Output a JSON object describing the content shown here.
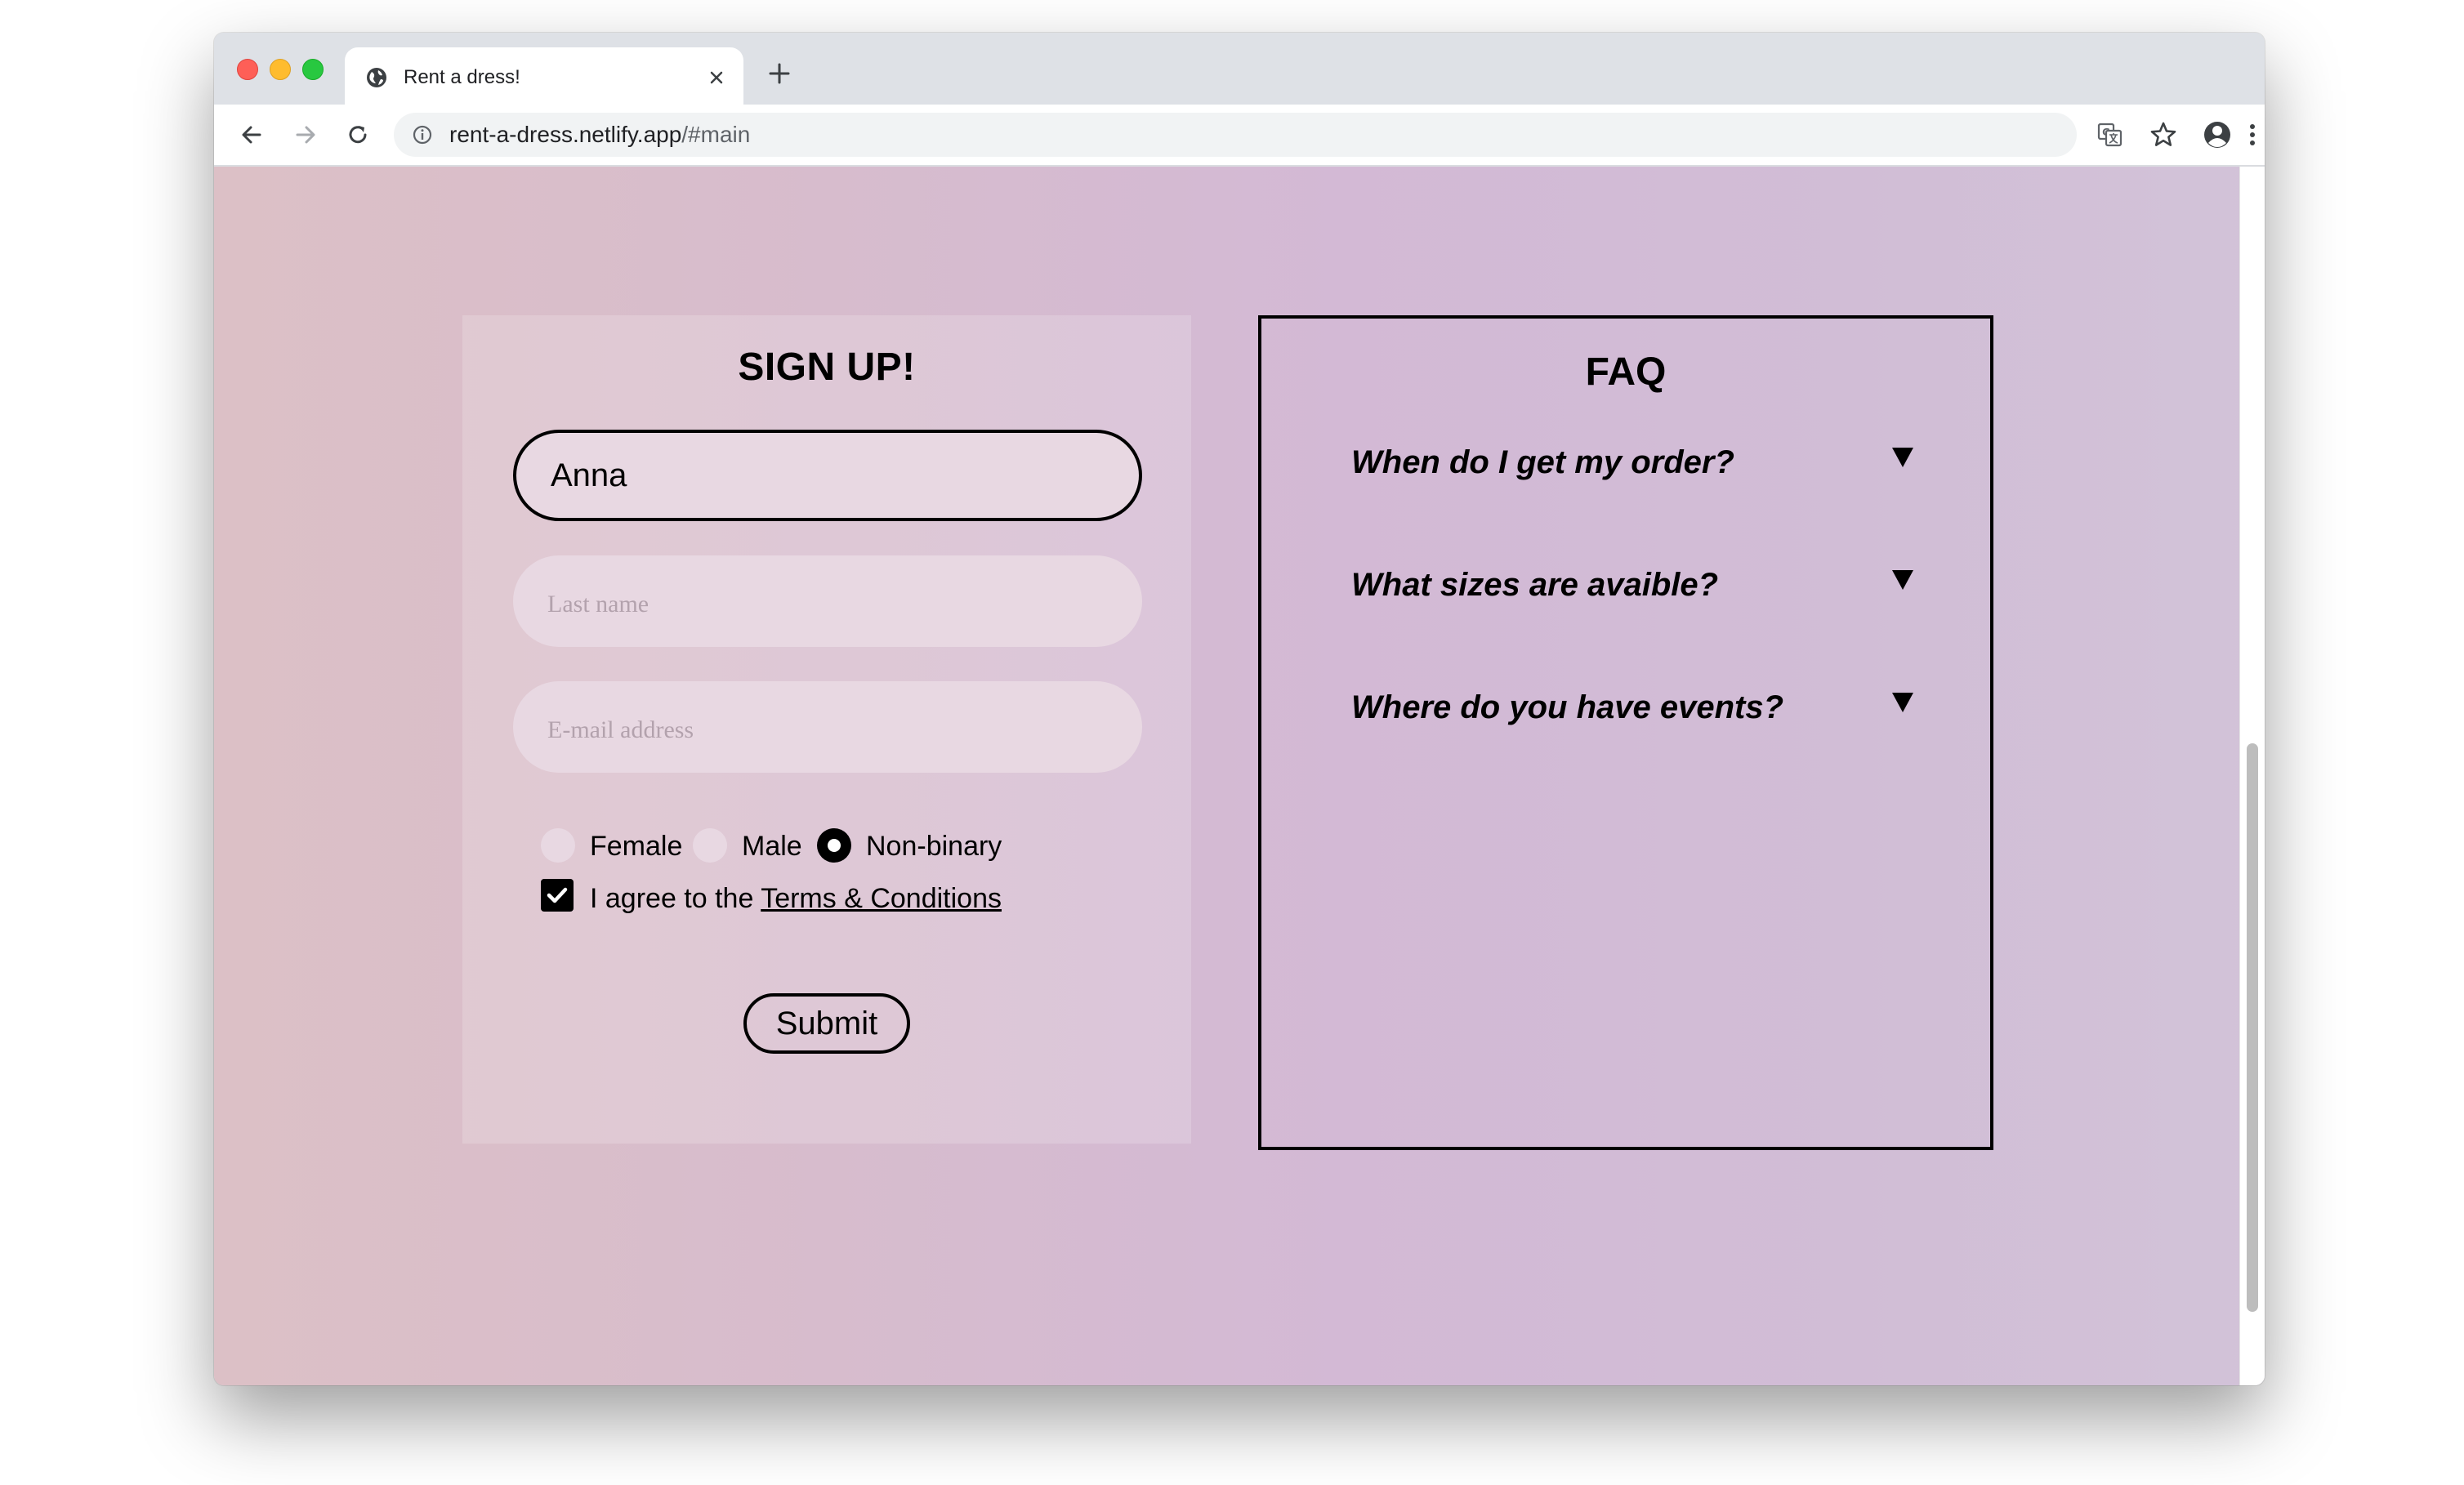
{
  "browser": {
    "tab_title": "Rent a dress!",
    "url_host": "rent-a-dress.netlify.app",
    "url_path": "/#main"
  },
  "signup": {
    "title": "SIGN UP!",
    "first_name_value": "Anna",
    "last_name_placeholder": "Last name",
    "email_placeholder": "E-mail address",
    "gender_options": [
      "Female",
      "Male",
      "Non-binary"
    ],
    "gender_selected": "Non-binary",
    "terms_prefix": "I agree to the ",
    "terms_link": "Terms & Conditions",
    "terms_checked": true,
    "submit_label": "Submit"
  },
  "faq": {
    "title": "FAQ",
    "items": [
      {
        "question": "When do I get my order?"
      },
      {
        "question": "What sizes are avaible?"
      },
      {
        "question": "Where do you have events?"
      }
    ]
  }
}
